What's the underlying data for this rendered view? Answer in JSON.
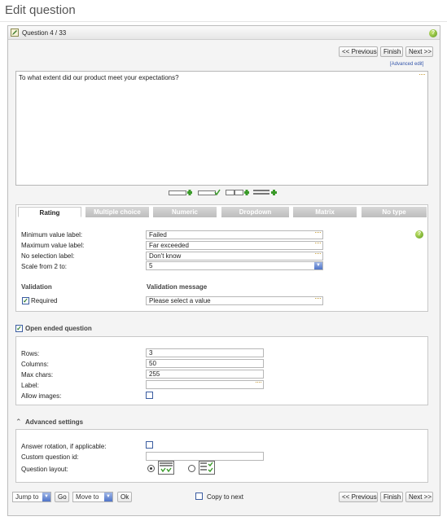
{
  "page": {
    "title": "Edit question"
  },
  "header": {
    "question_counter": "Question 4 / 33"
  },
  "nav": {
    "previous": "<< Previous",
    "finish": "Finish",
    "next": "Next >>"
  },
  "editor": {
    "advanced_edit": "[Advanced edit]",
    "question_text": "To what extent did our product meet your expectations?"
  },
  "tabs": [
    {
      "label": "Rating",
      "active": true
    },
    {
      "label": "Multiple choice",
      "active": false
    },
    {
      "label": "Numeric",
      "active": false
    },
    {
      "label": "Dropdown",
      "active": false
    },
    {
      "label": "Matrix",
      "active": false
    },
    {
      "label": "No type",
      "active": false
    }
  ],
  "rating": {
    "min_label": "Minimum value label:",
    "min_value": "Failed",
    "max_label": "Maximum value label:",
    "max_value": "Far exceeded",
    "nosel_label": "No selection label:",
    "nosel_value": "Don't know",
    "scale_label": "Scale from 2 to:",
    "scale_value": "5",
    "validation_head": "Validation",
    "validation_msg_head": "Validation message",
    "required_label": "Required",
    "required_checked": true,
    "validation_msg_value": "Please select a value"
  },
  "open_ended": {
    "title": "Open ended question",
    "enabled": true,
    "rows_label": "Rows:",
    "rows_value": "3",
    "cols_label": "Columns:",
    "cols_value": "50",
    "maxchars_label": "Max chars:",
    "maxchars_value": "255",
    "label_label": "Label:",
    "label_value": "",
    "allow_images_label": "Allow images:",
    "allow_images": false
  },
  "advanced": {
    "title": "Advanced settings",
    "rotation_label": "Answer rotation, if applicable:",
    "rotation": false,
    "custom_id_label": "Custom question id:",
    "custom_id_value": "",
    "layout_label": "Question layout:",
    "layout_selected": 1
  },
  "footer": {
    "jump_to": "Jump to",
    "go": "Go",
    "move_to": "Move to",
    "ok": "Ok",
    "copy_to_next": "Copy to next",
    "copy_checked": false
  },
  "icons": {
    "edit": "edit-pencil-icon",
    "help": "help-icon",
    "accent": "#5b9a1a",
    "link": "#3355aa"
  }
}
